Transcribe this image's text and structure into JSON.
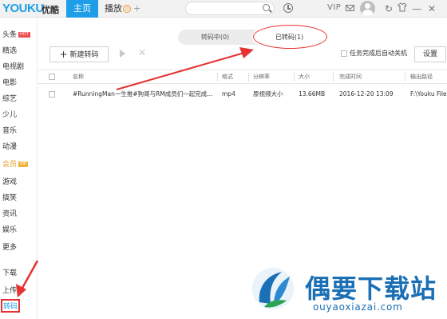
{
  "app": {
    "logo": "YOUKU",
    "logo_cn": "优酷"
  },
  "topbar": {
    "tab_home": "主页",
    "tab_play": "播放",
    "tab_play_badge": "0",
    "tab_add": "+",
    "vip": "VIP",
    "icons": [
      "search-icon",
      "history-icon",
      "mail-icon",
      "avatar",
      "refresh-icon",
      "skin-icon",
      "minimize-icon",
      "close-icon"
    ]
  },
  "sidebar": {
    "items": [
      {
        "label": "头条",
        "tag": "HOT"
      },
      {
        "label": "精选"
      },
      {
        "label": "电视剧"
      },
      {
        "label": "电影"
      },
      {
        "label": "综艺"
      },
      {
        "label": "少儿"
      },
      {
        "label": "音乐"
      },
      {
        "label": "动漫"
      },
      {
        "label": "会员",
        "tag": "VIP"
      },
      {
        "label": "游戏"
      },
      {
        "label": "搞笑"
      },
      {
        "label": "资讯"
      },
      {
        "label": "娱乐"
      },
      {
        "label": "更多"
      },
      {
        "label": "下载"
      },
      {
        "label": "上传"
      },
      {
        "label": "转码",
        "active": true
      }
    ]
  },
  "main": {
    "segment": {
      "tab_converting": "转码中(0)",
      "tab_converted": "已转码(1)",
      "active": "已转码(1)"
    },
    "toolbar": {
      "new_transcode": "新建转码",
      "new_icon": "+",
      "auto_shutdown_label": "任务完成后自动关机",
      "settings": "设置"
    },
    "table": {
      "columns": [
        "名称",
        "格式",
        "分辨率",
        "大小",
        "完成时间",
        "输出路径"
      ],
      "rows": [
        {
          "name": "#RunningMan一生推#狗哥与RM成员们一起完成...",
          "format": "mp4",
          "resolution": "原视频大小",
          "size": "13.66MB",
          "finished": "2016-12-20 13:09",
          "path": "F:\\Youku Files\\t"
        }
      ]
    }
  },
  "watermark": {
    "title": "偶要下载站",
    "url": "ouyaoxiazai.com"
  },
  "colors": {
    "accent": "#1f9ee8",
    "highlight": "#e53232",
    "watermark": "#1a6fb5"
  }
}
